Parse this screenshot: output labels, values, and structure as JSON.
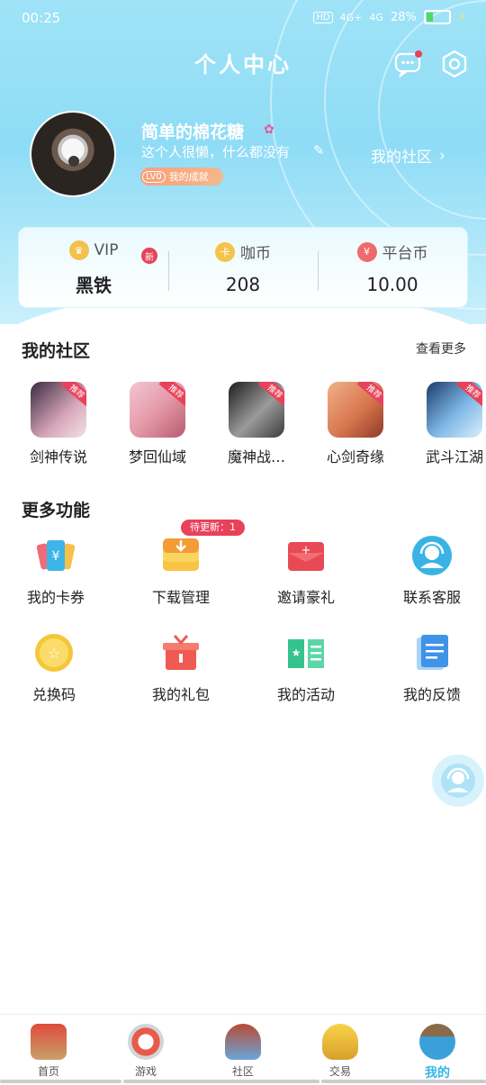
{
  "status": {
    "time": "00:25",
    "battery": "28%",
    "network": [
      "HD",
      "4G+",
      "4G"
    ]
  },
  "header": {
    "title": "个人中心"
  },
  "profile": {
    "username": "简单的棉花糖",
    "bio": "这个人很懒，什么都没有",
    "level": "LV0",
    "achievement": "我的成就",
    "community_link": "我的社区"
  },
  "stats": [
    {
      "label": "VIP",
      "value": "黑铁",
      "badge": "新"
    },
    {
      "label": "咖币",
      "value": "208"
    },
    {
      "label": "平台币",
      "value": "10.00"
    }
  ],
  "community": {
    "title": "我的社区",
    "see_more": "查看更多",
    "games": [
      {
        "name": "剑神传说",
        "tag": "推荐"
      },
      {
        "name": "梦回仙域",
        "tag": "推荐"
      },
      {
        "name": "魔神战…",
        "tag": "推荐"
      },
      {
        "name": "心剑奇缘",
        "tag": "推荐"
      },
      {
        "name": "武斗江湖",
        "tag": "推荐"
      }
    ]
  },
  "more": {
    "title": "更多功能",
    "pending_badge": "待更新：1",
    "items": [
      {
        "name": "我的卡券",
        "icon": "coupon-icon"
      },
      {
        "name": "下载管理",
        "icon": "download-icon"
      },
      {
        "name": "邀请豪礼",
        "icon": "invite-envelope-icon"
      },
      {
        "name": "联系客服",
        "icon": "customer-service-icon"
      },
      {
        "name": "兑换码",
        "icon": "redeem-code-icon"
      },
      {
        "name": "我的礼包",
        "icon": "gift-box-icon"
      },
      {
        "name": "我的活动",
        "icon": "activity-book-icon"
      },
      {
        "name": "我的反馈",
        "icon": "feedback-document-icon"
      }
    ]
  },
  "tabs": [
    {
      "label": "首页",
      "icon": "home-pavilion-icon"
    },
    {
      "label": "游戏",
      "icon": "game-icon"
    },
    {
      "label": "社区",
      "icon": "community-icon"
    },
    {
      "label": "交易",
      "icon": "trade-gold-icon"
    },
    {
      "label": "我的",
      "icon": "mine-character-icon",
      "active": true
    }
  ],
  "colors": {
    "accent": "#35b5e8",
    "badge_red": "#e8425b",
    "header": "#8fdcf6"
  }
}
